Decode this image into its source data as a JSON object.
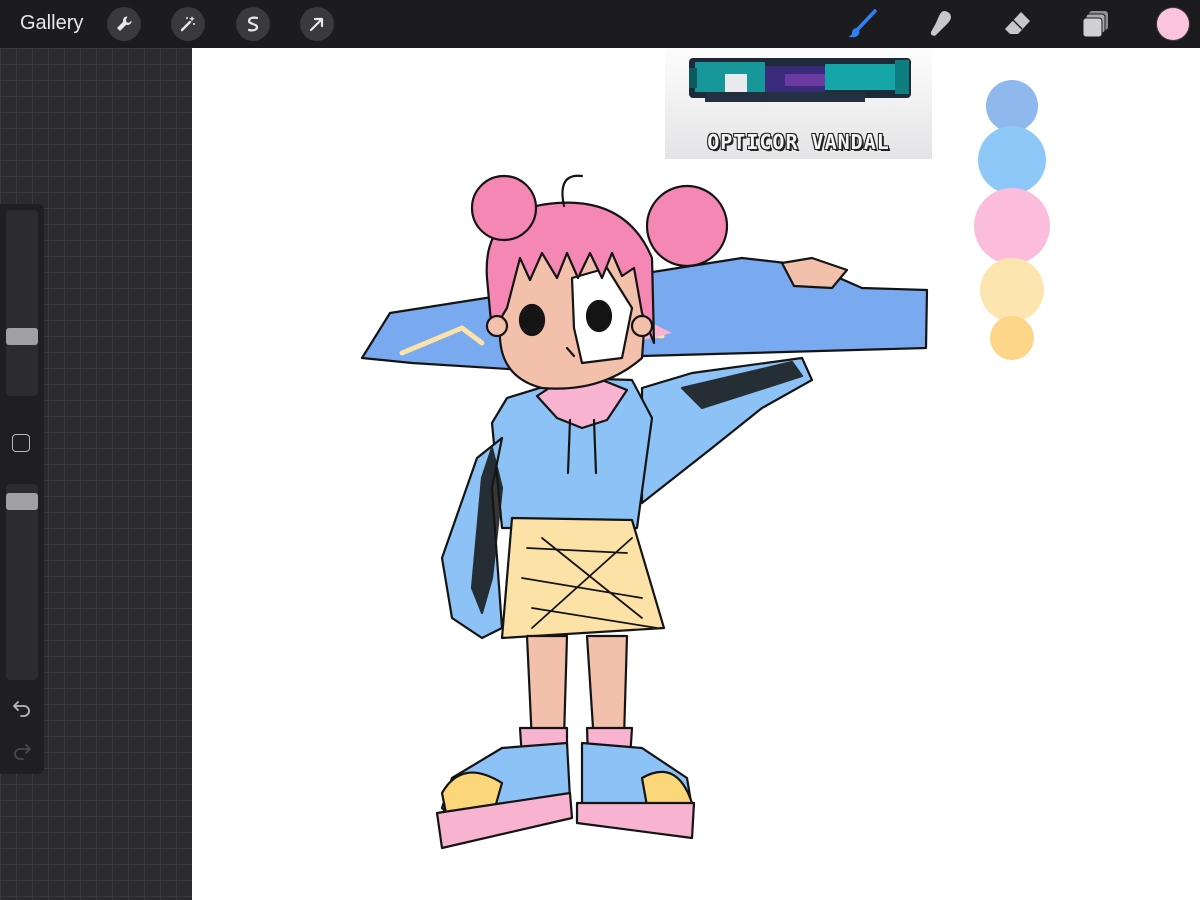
{
  "toolbar": {
    "gallery_label": "Gallery",
    "left_tools": [
      "wrench-icon",
      "magic-wand-icon",
      "selection-icon",
      "transform-arrow-icon"
    ],
    "right_tools": [
      "brush-icon",
      "smudge-icon",
      "eraser-icon",
      "layers-icon"
    ],
    "active_tool": "brush-icon",
    "current_color": "#fbc4dc"
  },
  "sidebar": {
    "brush_size_level": 0.3,
    "opacity_level": 0.95,
    "icons": [
      "modify-square-icon",
      "undo-icon",
      "redo-icon"
    ]
  },
  "canvas": {
    "reference_image": {
      "caption": "OPTICOR VANDAL"
    },
    "palette_swatches": [
      "#8fb8ef",
      "#8ec8f9",
      "#fcbcdc",
      "#fde5b0",
      "#fdd68a"
    ],
    "colors": {
      "hair_pink": "#f487b3",
      "hoodie_blue": "#8cc2f5",
      "skirt_yellow": "#fde2a8",
      "skin": "#f3c0ac",
      "gun_blue": "#79a9ee",
      "outline": "#141414"
    }
  }
}
